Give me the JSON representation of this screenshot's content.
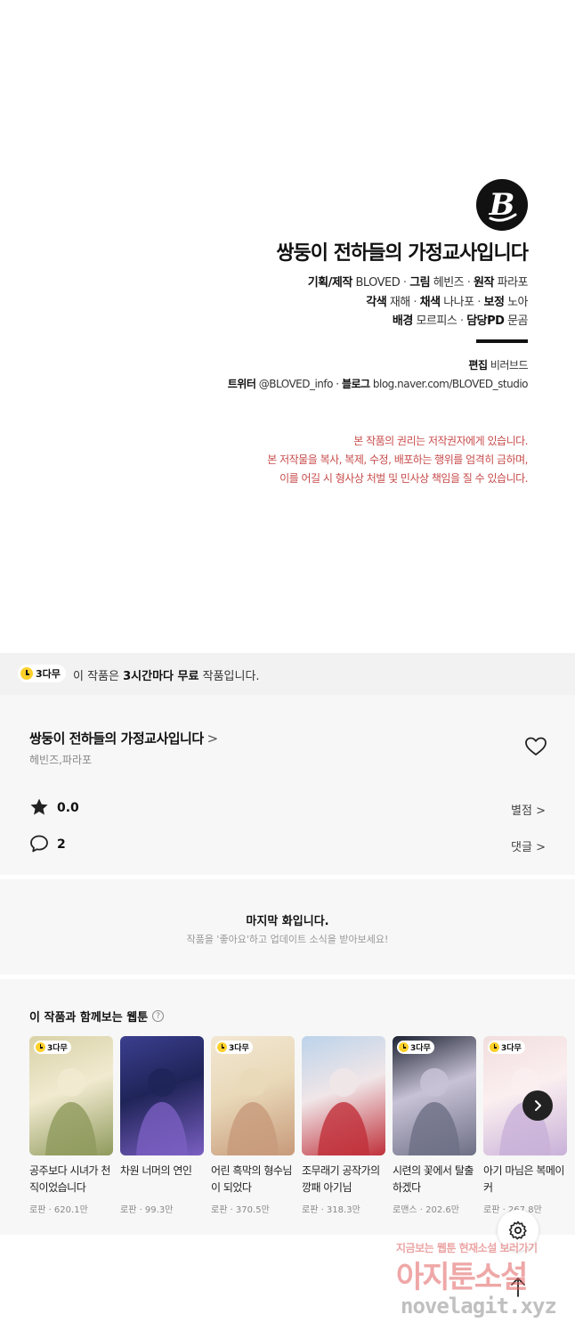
{
  "credits": {
    "title": "쌍둥이 전하들의 가정교사입니다",
    "lines": [
      [
        {
          "k": "기획/제작",
          "v": "BLOVED"
        },
        {
          "k": "그림",
          "v": "헤빈즈"
        },
        {
          "k": "원작",
          "v": "파라포"
        }
      ],
      [
        {
          "k": "각색",
          "v": "재해"
        },
        {
          "k": "채색",
          "v": "나나포"
        },
        {
          "k": "보정",
          "v": "노아"
        }
      ],
      [
        {
          "k": "배경",
          "v": "모르피스"
        },
        {
          "k": "담당PD",
          "v": "문곰"
        }
      ]
    ],
    "editor_label": "편집",
    "editor": "비러브드",
    "twitter_label": "트위터",
    "twitter": "@BLOVED_info",
    "blog_label": "블로그",
    "blog": "blog.naver.com/BLOVED_studio",
    "notice": [
      "본 작품의 권리는 저작권자에게 있습니다.",
      "본 저작물을 복사, 복제, 수정, 배포하는 행위를 엄격히 금하며,",
      "이를 어길 시 형사상 처벌 및 민사상 책임을 질 수 있습니다."
    ]
  },
  "free_banner": {
    "badge": "3다무",
    "text_pre": "이 작품은",
    "text_bold": "3시간마다 무료",
    "text_post": "작품입니다."
  },
  "work": {
    "title": "쌍둥이 전하들의 가정교사입니다",
    "chevron": ">",
    "authors": "헤빈즈,파라포",
    "rating": "0.0",
    "rating_link": "별점 >",
    "comments": "2",
    "comments_link": "댓글 >"
  },
  "last_episode": {
    "title": "마지막 화입니다.",
    "subtitle": "작품을 '좋아요'하고 업데이트 소식을 받아보세요!"
  },
  "recommendations": {
    "heading": "이 작품과 함께보는 웹툰",
    "help": "?",
    "items": [
      {
        "title": "공주보다 시녀가 천직이었습니다",
        "meta": "로판 · 620.1만",
        "badge": "3다무",
        "colors": [
          "#d9d2a8",
          "#8f9a5c",
          "#f1ead0"
        ]
      },
      {
        "title": "차원 너머의 연인",
        "meta": "로판 · 99.3만",
        "badge": "",
        "colors": [
          "#3b3f8f",
          "#7a5fc2",
          "#1f2458"
        ]
      },
      {
        "title": "어린 흑막의 형수님이 되었다",
        "meta": "로판 · 370.5만",
        "badge": "3다무",
        "colors": [
          "#f3e7d2",
          "#c79a7a",
          "#e9d9b9"
        ]
      },
      {
        "title": "조무래기 공작가의 깡패 아기님",
        "meta": "로판 · 318.3만",
        "badge": "",
        "colors": [
          "#bcd3ea",
          "#c0303a",
          "#f0e6e8"
        ]
      },
      {
        "title": "시련의 꽃에서 탈출하겠다",
        "meta": "로맨스 · 202.6만",
        "badge": "3다무",
        "colors": [
          "#1d2333",
          "#6d6f86",
          "#c8c2d6"
        ]
      },
      {
        "title": "아기 마님은 복메이커",
        "meta": "로판 · 267.8만",
        "badge": "3다무",
        "colors": [
          "#f2dede",
          "#c8b0d8",
          "#fbeff0"
        ]
      }
    ]
  },
  "watermark": {
    "line1": "지금보는 웹툰 현재소설 보러가기",
    "line2": "아지툰소설",
    "line3": "novelagit.xyz"
  },
  "icons": {
    "logo": "bloved-logo-icon",
    "clock": "clock-icon",
    "heart": "heart-icon",
    "star": "star-icon",
    "comment": "comment-icon",
    "next": "chevron-right-icon",
    "settings": "gear-icon",
    "top": "arrow-up-icon"
  },
  "colors": {
    "notice": "#c84b4b",
    "badge_yellow": "#ffd02a",
    "panel_bg": "#f7f7f7",
    "banner_bg": "#f2f2f2"
  }
}
